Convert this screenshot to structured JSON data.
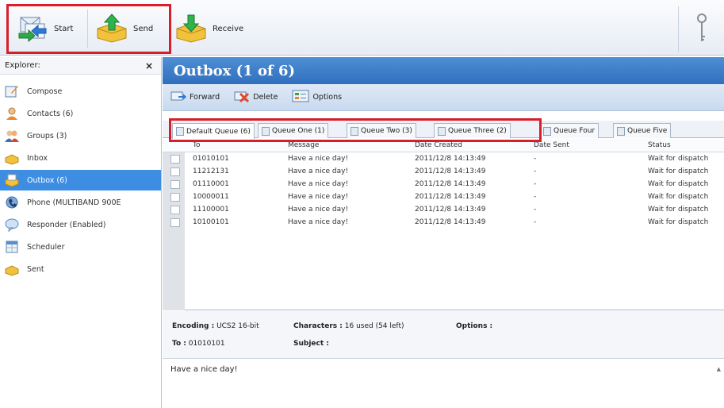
{
  "toolbar": {
    "start_label": "Start",
    "send_label": "Send",
    "receive_label": "Receive"
  },
  "explorer": {
    "title": "Explorer:",
    "close": "×",
    "items": [
      {
        "label": "Compose",
        "icon": "compose-icon"
      },
      {
        "label": "Contacts  (6)",
        "icon": "contacts-icon"
      },
      {
        "label": "Groups  (3)",
        "icon": "groups-icon"
      },
      {
        "label": "Inbox",
        "icon": "inbox-icon"
      },
      {
        "label": "Outbox  (6)",
        "icon": "outbox-icon"
      },
      {
        "label": "Phone  (MULTIBAND  900E",
        "icon": "phone-icon"
      },
      {
        "label": "Responder  (Enabled)",
        "icon": "responder-icon"
      },
      {
        "label": "Scheduler",
        "icon": "scheduler-icon"
      },
      {
        "label": "Sent",
        "icon": "sent-icon"
      }
    ]
  },
  "main": {
    "title": "Outbox (1 of 6)",
    "actions": {
      "forward": "Forward",
      "delete": "Delete",
      "options": "Options"
    },
    "tabs": [
      "Default Queue (6)",
      "Queue One (1)",
      "Queue Two (3)",
      "Queue Three (2)",
      "Queue Four",
      "Queue Five"
    ],
    "columns": [
      "To",
      "Message",
      "Date Created",
      "Date Sent",
      "Status"
    ],
    "rows": [
      {
        "to": "01010101",
        "message": "Have a nice day!",
        "created": "2011/12/8 14:13:49",
        "sent": "-",
        "status": "Wait for dispatch"
      },
      {
        "to": "11212131",
        "message": "Have a nice day!",
        "created": "2011/12/8 14:13:49",
        "sent": "-",
        "status": "Wait for dispatch"
      },
      {
        "to": "01110001",
        "message": "Have a nice day!",
        "created": "2011/12/8 14:13:49",
        "sent": "-",
        "status": "Wait for dispatch"
      },
      {
        "to": "10000011",
        "message": "Have a nice day!",
        "created": "2011/12/8 14:13:49",
        "sent": "-",
        "status": "Wait for dispatch"
      },
      {
        "to": "11100001",
        "message": "Have a nice day!",
        "created": "2011/12/8 14:13:49",
        "sent": "-",
        "status": "Wait for dispatch"
      },
      {
        "to": "10100101",
        "message": "Have a nice day!",
        "created": "2011/12/8 14:13:49",
        "sent": "-",
        "status": "Wait for dispatch"
      }
    ],
    "detail": {
      "encoding_label": "Encoding :",
      "encoding_value": "UCS2 16-bit",
      "characters_label": "Characters :",
      "characters_value": "16 used (54 left)",
      "options_label": "Options :",
      "to_label": "To :",
      "to_value": "01010101",
      "subject_label": "Subject :"
    },
    "body": "Have a nice day!"
  },
  "colors": {
    "title_bar": "#3a7bc8",
    "selected": "#3d8ee2",
    "highlight_box": "#d81e2a"
  }
}
